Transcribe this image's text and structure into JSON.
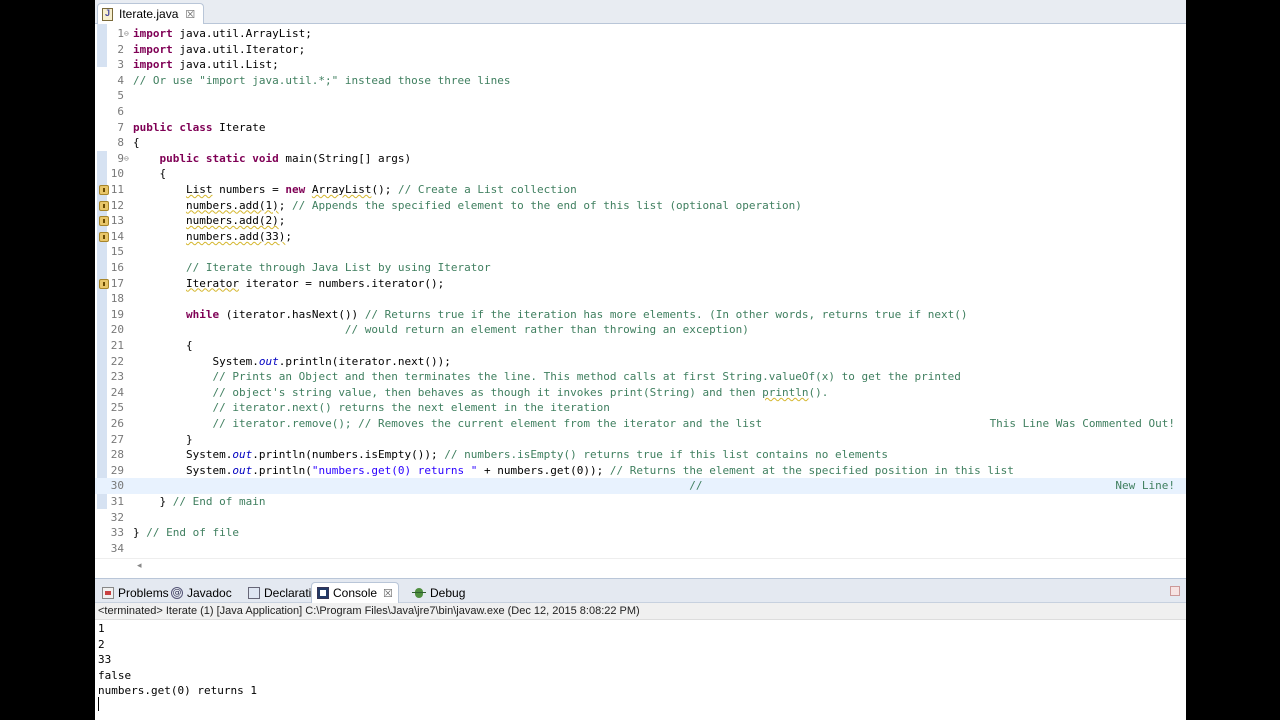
{
  "editor_tab": {
    "label": "Iterate.java",
    "close": "☒"
  },
  "code_lines": [
    {
      "n": "1",
      "fold": "⊖",
      "html": "<span class=\"kw\">import</span> java.util.ArrayList;"
    },
    {
      "n": "2",
      "html": "<span class=\"kw\">import</span> java.util.Iterator;"
    },
    {
      "n": "3",
      "html": "<span class=\"kw\">import</span> java.util.List;"
    },
    {
      "n": "4",
      "html": "<span class=\"cm\">// Or use \"import java.util.*;\" instead those three lines</span>"
    },
    {
      "n": "5",
      "html": ""
    },
    {
      "n": "6",
      "html": ""
    },
    {
      "n": "7",
      "html": "<span class=\"kw\">public class</span> Iterate"
    },
    {
      "n": "8",
      "html": "{"
    },
    {
      "n": "9",
      "fold": "⊖",
      "html": "    <span class=\"kw\">public static void</span> main(String[] args)"
    },
    {
      "n": "10",
      "html": "    {"
    },
    {
      "n": "11",
      "warn": true,
      "html": "        <span class=\"squig\">List</span> numbers = <span class=\"kw\">new</span> <span class=\"squig\">ArrayList</span>(); <span class=\"cm\">// Create a List collection</span>"
    },
    {
      "n": "12",
      "warn": true,
      "html": "        <span class=\"squig\">numbers.add(1)</span>; <span class=\"cm\">// Appends the specified element to the end of this list (optional operation)</span>"
    },
    {
      "n": "13",
      "warn": true,
      "html": "        <span class=\"squig\">numbers.add(2)</span>;"
    },
    {
      "n": "14",
      "warn": true,
      "html": "        <span class=\"squig\">numbers.add(33)</span>;"
    },
    {
      "n": "15",
      "html": ""
    },
    {
      "n": "16",
      "html": "        <span class=\"cm\">// Iterate through Java List by using Iterator</span>"
    },
    {
      "n": "17",
      "warn": true,
      "html": "        <span class=\"squig\">Iterator</span> iterator = numbers.iterator();"
    },
    {
      "n": "18",
      "html": ""
    },
    {
      "n": "19",
      "html": "        <span class=\"kw\">while</span> (iterator.hasNext()) <span class=\"cm\">// Returns true if the iteration has more elements. (In other words, returns true if next()</span>"
    },
    {
      "n": "20",
      "html": "                                <span class=\"cm\">// would return an element rather than throwing an exception)</span>"
    },
    {
      "n": "21",
      "html": "        {"
    },
    {
      "n": "22",
      "html": "            System.<span class=\"fld\">out</span>.println(iterator.next());"
    },
    {
      "n": "23",
      "html": "            <span class=\"cm\">// Prints an Object and then terminates the line. This method calls at first String.valueOf(x) to get the printed</span>"
    },
    {
      "n": "24",
      "html": "            <span class=\"cm\">// object's string value, then behaves as though it invokes print(String) and then <span class=\"squig\">println</span>().</span>"
    },
    {
      "n": "25",
      "html": "            <span class=\"cm\">// iterator.next() returns the next element in the iteration</span>"
    },
    {
      "n": "26",
      "html": "            <span class=\"cm\">// iterator.remove(); // Removes the current element from the iterator and the list</span>",
      "right": "This Line Was Commented Out!"
    },
    {
      "n": "27",
      "html": "        }"
    },
    {
      "n": "28",
      "html": "        System.<span class=\"fld\">out</span>.println(numbers.isEmpty()); <span class=\"cm\">// numbers.isEmpty() returns true if this list contains no elements</span>"
    },
    {
      "n": "29",
      "html": "        System.<span class=\"fld\">out</span>.println(<span class=\"str\">\"numbers.get(0) returns \"</span> + numbers.get(0)); <span class=\"cm\">// Returns the element at the specified position in this list</span>"
    },
    {
      "n": "30",
      "current": true,
      "html": "                                                                                    <span class=\"cm\">//</span>",
      "right": "New Line!"
    },
    {
      "n": "31",
      "html": "    } <span class=\"cm\">// End of main</span>"
    },
    {
      "n": "32",
      "html": ""
    },
    {
      "n": "33",
      "html": "} <span class=\"cm\">// End of file</span>"
    },
    {
      "n": "34",
      "html": ""
    }
  ],
  "panel_tabs": [
    {
      "label": "Problems",
      "icon": "problems-icon"
    },
    {
      "label": "Javadoc",
      "icon": "javadoc-icon"
    },
    {
      "label": "Declaration",
      "icon": "declaration-icon"
    },
    {
      "label": "Console",
      "icon": "console-icon",
      "active": true,
      "close": "☒"
    },
    {
      "label": "Debug",
      "icon": "debug-icon"
    }
  ],
  "console_status": "<terminated> Iterate (1) [Java Application] C:\\Program Files\\Java\\jre7\\bin\\javaw.exe (Dec 12, 2015 8:08:22 PM)",
  "console_output": [
    "1",
    "2",
    "33",
    "false",
    "numbers.get(0) returns 1"
  ],
  "hscroll_arrow": "◂"
}
